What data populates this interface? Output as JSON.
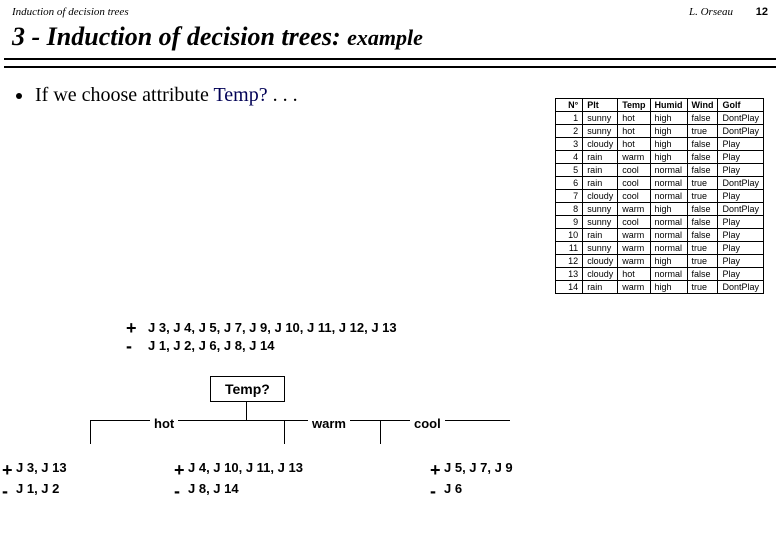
{
  "header": {
    "topic": "Induction of decision trees",
    "author": "L. Orseau",
    "page": "12"
  },
  "title": {
    "num": "3 - ",
    "main": "Induction of decision trees: ",
    "suffix": "example"
  },
  "question": {
    "pre": "If we choose attribute ",
    "attr": "Temp?",
    "post": " . . ."
  },
  "table": {
    "headers": [
      "N°",
      "Plt",
      "Temp",
      "Humid",
      "Wind",
      "Golf"
    ],
    "rows": [
      [
        "1",
        "sunny",
        "hot",
        "high",
        "false",
        "DontPlay"
      ],
      [
        "2",
        "sunny",
        "hot",
        "high",
        "true",
        "DontPlay"
      ],
      [
        "3",
        "cloudy",
        "hot",
        "high",
        "false",
        "Play"
      ],
      [
        "4",
        "rain",
        "warm",
        "high",
        "false",
        "Play"
      ],
      [
        "5",
        "rain",
        "cool",
        "normal",
        "false",
        "Play"
      ],
      [
        "6",
        "rain",
        "cool",
        "normal",
        "true",
        "DontPlay"
      ],
      [
        "7",
        "cloudy",
        "cool",
        "normal",
        "true",
        "Play"
      ],
      [
        "8",
        "sunny",
        "warm",
        "high",
        "false",
        "DontPlay"
      ],
      [
        "9",
        "sunny",
        "cool",
        "normal",
        "false",
        "Play"
      ],
      [
        "10",
        "rain",
        "warm",
        "normal",
        "false",
        "Play"
      ],
      [
        "11",
        "sunny",
        "warm",
        "normal",
        "true",
        "Play"
      ],
      [
        "12",
        "cloudy",
        "warm",
        "high",
        "true",
        "Play"
      ],
      [
        "13",
        "cloudy",
        "hot",
        "normal",
        "false",
        "Play"
      ],
      [
        "14",
        "rain",
        "warm",
        "high",
        "true",
        "DontPlay"
      ]
    ]
  },
  "tree": {
    "root_plus": "+",
    "root_minus": "-",
    "root_pos": "J 3, J 4, J 5, J 7, J 9, J 10, J 11, J 12, J 13",
    "root_neg": "J 1, J 2, J 6, J 8, J 14",
    "node": "Temp?",
    "branches": {
      "a": "hot",
      "b": "warm",
      "c": "cool"
    },
    "leaves": {
      "a_pos": "J 3, J 13",
      "a_neg": "J 1, J 2",
      "b_pos": "J 4, J 10, J 11, J 13",
      "b_neg": "J 8, J 14",
      "c_pos": "J 5, J 7, J 9",
      "c_neg": "J 6"
    }
  }
}
